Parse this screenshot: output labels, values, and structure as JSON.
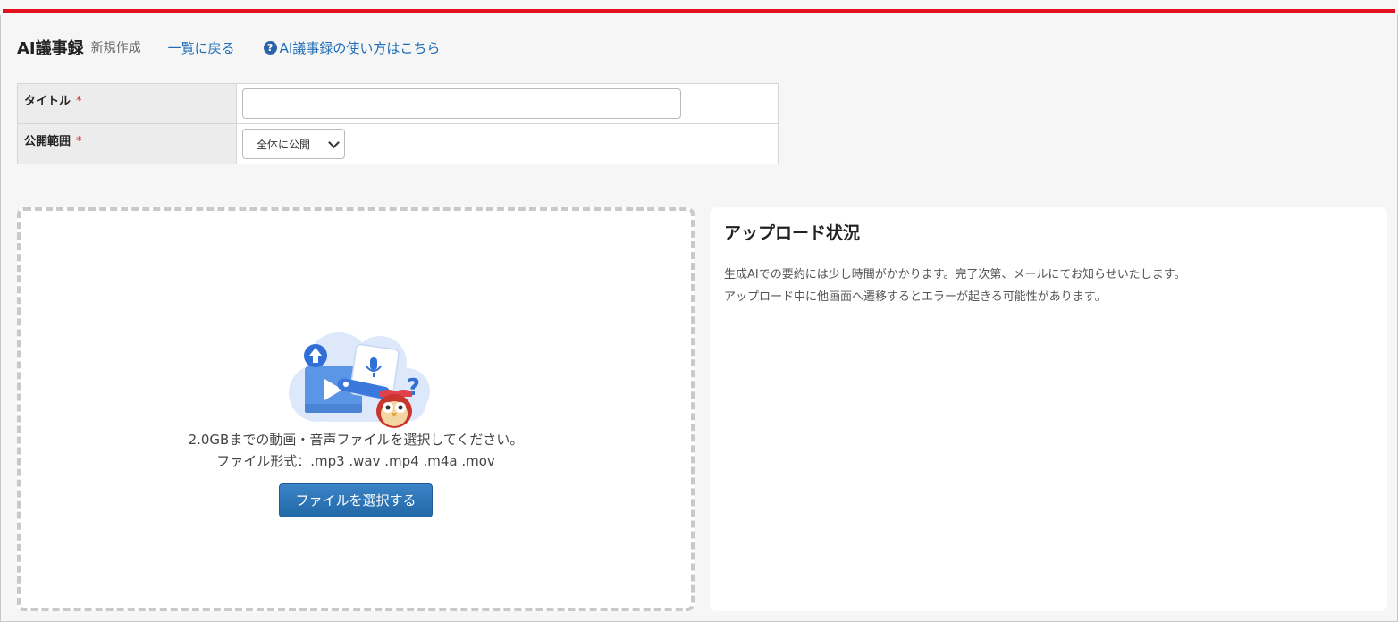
{
  "header": {
    "app_title": "AI議事録",
    "page_sub": "新規作成",
    "back_link": "一覧に戻る",
    "help_link": "AI議事録の使い方はこちら"
  },
  "form": {
    "title_label": "タイトル",
    "title_value": "",
    "title_placeholder": "",
    "scope_label": "公開範囲",
    "scope_selected": "全体に公開",
    "required_mark": "*"
  },
  "upload": {
    "instruction": "2.0GBまでの動画・音声ファイルを選択してください。",
    "formats": "ファイル形式：.mp3 .wav .mp4 .m4a .mov",
    "button_label": "ファイルを選択する"
  },
  "status": {
    "title": "アップロード状況",
    "note_1": "生成AIでの要約には少し時間がかかります。完了次第、メールにてお知らせいたします。",
    "note_2": "アップロード中に他画面へ遷移するとエラーが起きる可能性があります。"
  },
  "colors": {
    "accent_red": "#e3111d",
    "link_blue": "#1e6cb5",
    "button_blue": "#2369a8"
  },
  "icons": {
    "help": "question-circle-icon",
    "dropdown": "chevron-down-icon",
    "illustration": "upload-media-illustration"
  }
}
